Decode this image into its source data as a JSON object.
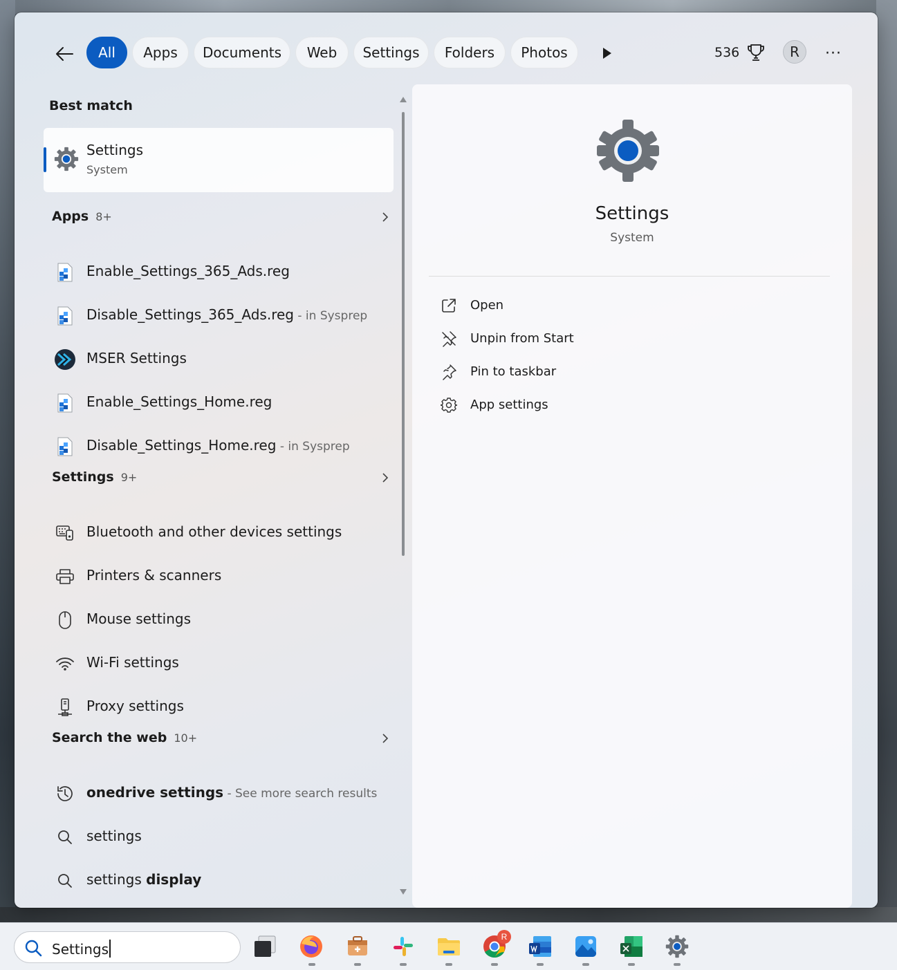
{
  "filters": {
    "back_label": "Back",
    "chips": [
      "All",
      "Apps",
      "Documents",
      "Web",
      "Settings",
      "Folders",
      "Photos"
    ],
    "active": "All",
    "points": "536",
    "avatar_initial": "R",
    "more_label": "···"
  },
  "best_match": {
    "heading": "Best match",
    "name": "Settings",
    "subtitle": "System"
  },
  "apps_section": {
    "heading": "Apps",
    "count": "8+",
    "items": [
      {
        "name": "Enable_Settings_365_Ads.reg",
        "suffix": ""
      },
      {
        "name": "Disable_Settings_365_Ads.reg",
        "suffix": " - in Sysprep"
      },
      {
        "name": "MSER Settings",
        "suffix": ""
      },
      {
        "name": "Enable_Settings_Home.reg",
        "suffix": ""
      },
      {
        "name": "Disable_Settings_Home.reg",
        "suffix": " - in Sysprep"
      }
    ]
  },
  "settings_section": {
    "heading": "Settings",
    "count": "9+",
    "items": [
      "Bluetooth and other devices settings",
      "Printers & scanners",
      "Mouse settings",
      "Wi-Fi settings",
      "Proxy settings"
    ]
  },
  "web_section": {
    "heading": "Search the web",
    "count": "10+",
    "items": [
      {
        "bold": "onedrive settings",
        "rest": "",
        "suffix": " - See more search results"
      },
      {
        "bold": "",
        "rest": "settings",
        "suffix": ""
      },
      {
        "bold": "display",
        "rest": "settings ",
        "suffix": ""
      }
    ],
    "cut_off_item": "settings"
  },
  "details": {
    "name": "Settings",
    "subtitle": "System",
    "actions": [
      "Open",
      "Unpin from Start",
      "Pin to taskbar",
      "App settings"
    ]
  },
  "taskbar": {
    "search_value": "Settings",
    "chrome_badge": "R",
    "apps": [
      "task-view",
      "firefox",
      "toolbox",
      "slack",
      "file-explorer",
      "chrome",
      "word",
      "photos",
      "excel",
      "settings"
    ]
  },
  "colors": {
    "accent": "#0b5cc1",
    "gear": "#6d7278",
    "gear_center": "#0b5cc1"
  }
}
